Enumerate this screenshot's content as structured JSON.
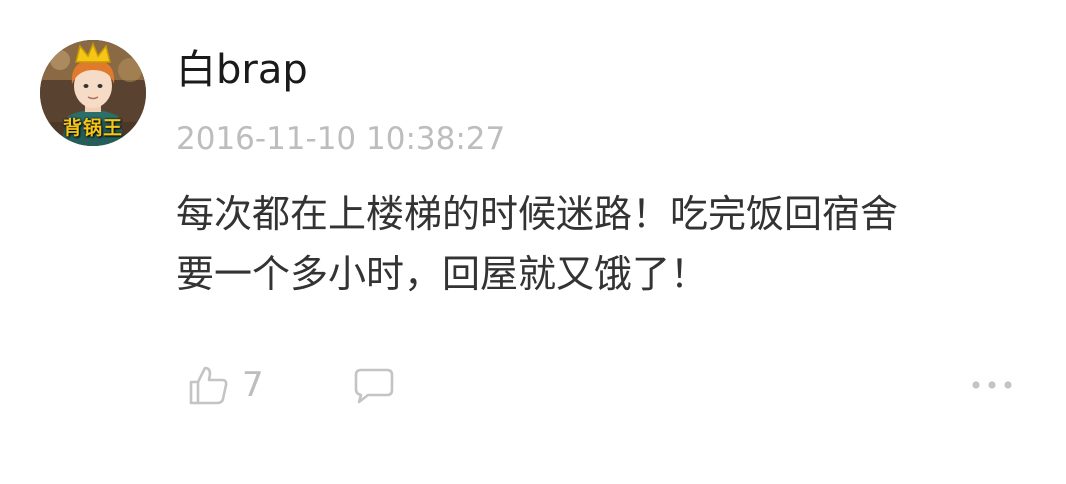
{
  "comment": {
    "username": "白brap",
    "timestamp": "2016-11-10 10:38:27",
    "lines": [
      "每次都在上楼梯的时候迷路！吃完饭回宿舍",
      "要一个多小时，回屋就又饿了！"
    ],
    "avatar_badge_text": "背锅王",
    "like_count": "7"
  },
  "icons": {
    "like": "thumbs-up-icon",
    "comment": "comment-bubble-icon",
    "more": "more-dots-icon"
  },
  "colors": {
    "username": "#1a1a1a",
    "timestamp": "#bdbdbd",
    "body_text": "#333333",
    "icon": "#c4c4c4"
  }
}
